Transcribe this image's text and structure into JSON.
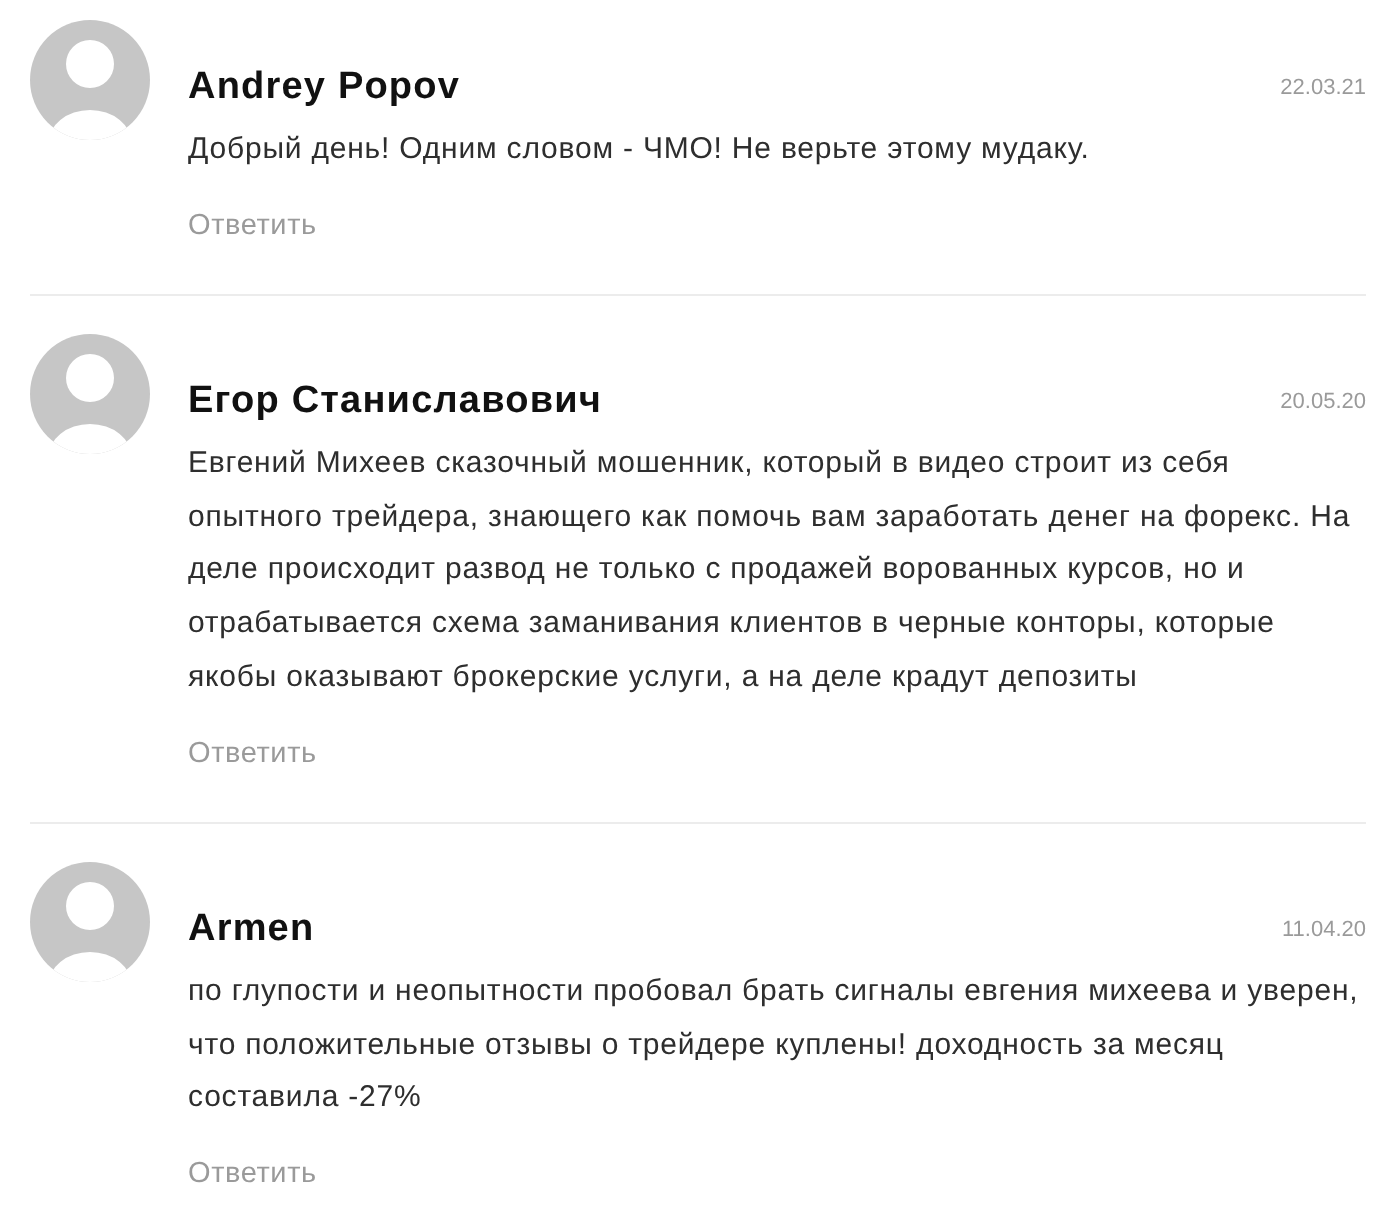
{
  "comments": [
    {
      "author": "Andrey Popov",
      "date": "22.03.21",
      "text": "Добрый день! Одним словом - ЧМО! Не верьте этому мудаку.",
      "reply": "Ответить"
    },
    {
      "author": "Егор Станиславович",
      "date": "20.05.20",
      "text": "Евгений Михеев сказочный мошенник, который в видео строит из себя опытного трейдера, знающего как помочь вам заработать денег на форекс. На деле происходит развод не только с продажей ворованных курсов, но и отрабатывается схема заманивания клиентов в черные конторы, которые якобы оказывают брокерские услуги, а на деле крадут депозиты",
      "reply": "Ответить"
    },
    {
      "author": "Armen",
      "date": "11.04.20",
      "text": "по глупости и неопытности пробовал брать сигналы евгения михеева и уверен, что положительные отзывы о трейдере куплены! доходность за месяц\nсоставила -27%",
      "reply": "Ответить"
    }
  ]
}
